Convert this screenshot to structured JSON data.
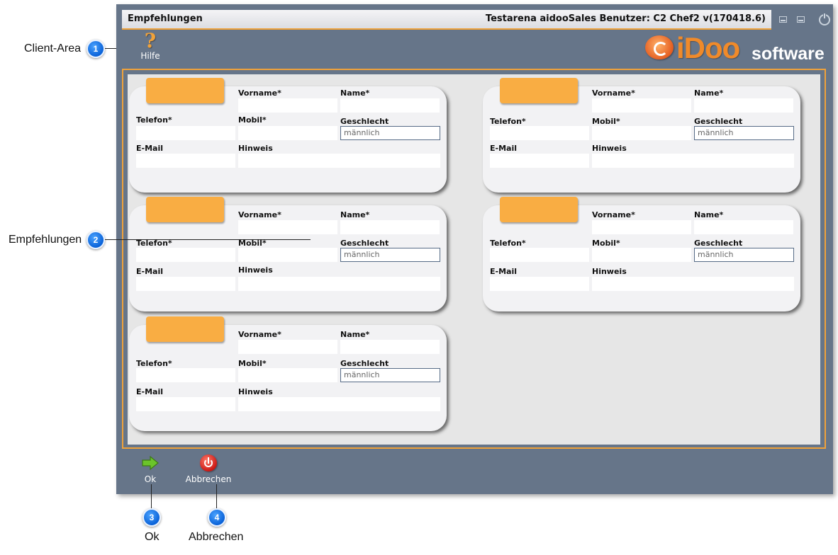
{
  "window": {
    "title": "Empfehlungen",
    "user_info": "Testarena aidooSales Benutzer: C2 Chef2 v(170418.6)"
  },
  "toolbar": {
    "help_label": "Hilfe",
    "help_glyph": "?"
  },
  "logo": {
    "brand_main": "iDoo",
    "brand_sub": "software"
  },
  "card_labels": {
    "vorname": "Vorname*",
    "name": "Name*",
    "telefon": "Telefon*",
    "mobil": "Mobil*",
    "geschlecht": "Geschlecht",
    "email": "E-Mail",
    "hinweis": "Hinweis"
  },
  "cards": [
    {
      "geschlecht": "männlich"
    },
    {
      "geschlecht": "männlich"
    },
    {
      "geschlecht": "männlich"
    },
    {
      "geschlecht": "männlich"
    },
    {
      "geschlecht": "männlich"
    }
  ],
  "footer": {
    "ok_label": "Ok",
    "cancel_label": "Abbrechen"
  },
  "annotations": {
    "client_area": "Client-Area",
    "empfehlungen": "Empfehlungen",
    "ok": "Ok",
    "abbrechen": "Abbrechen",
    "badge1": "1",
    "badge2": "2",
    "badge3": "3",
    "badge4": "4"
  },
  "colors": {
    "window_bg": "#667589",
    "accent_orange": "#f0a23a",
    "card_tab": "#f9ad43",
    "badge_blue": "#0a62d8"
  }
}
